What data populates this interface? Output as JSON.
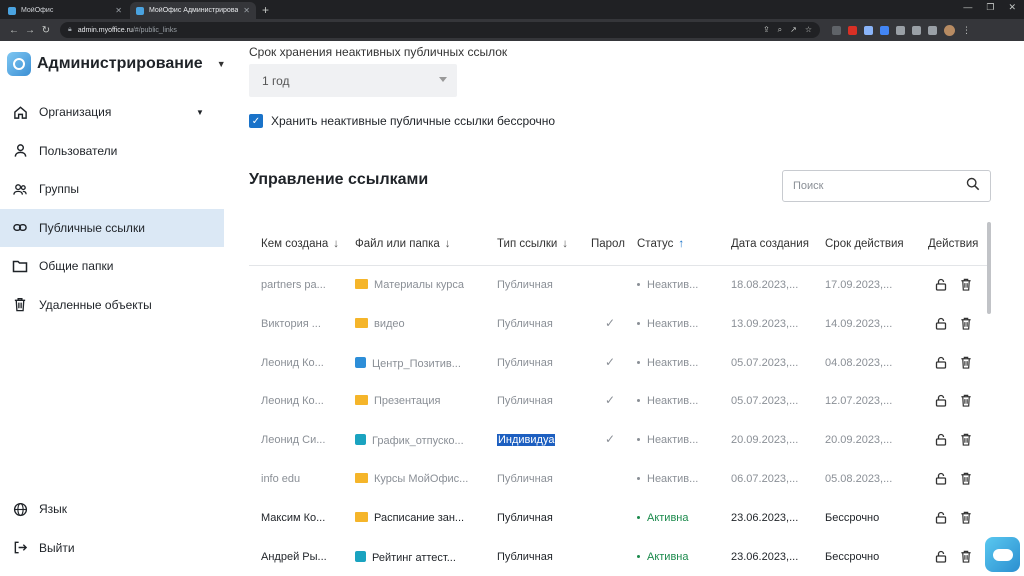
{
  "browser": {
    "tabs": [
      {
        "title": "МойОфис",
        "active": false
      },
      {
        "title": "МойОфис Администрирование",
        "active": true
      }
    ],
    "url_host": "admin.myoffice.ru",
    "url_path": "/#/public_links"
  },
  "sidebar": {
    "title": "Администрирование",
    "items": [
      {
        "label": "Организация",
        "icon": "home-icon",
        "active": false,
        "has_caret": true
      },
      {
        "label": "Пользователи",
        "icon": "user-icon",
        "active": false
      },
      {
        "label": "Группы",
        "icon": "group-icon",
        "active": false
      },
      {
        "label": "Публичные ссылки",
        "icon": "link-icon",
        "active": true
      },
      {
        "label": "Общие папки",
        "icon": "folder-icon",
        "active": false
      },
      {
        "label": "Удаленные объекты",
        "icon": "trash-icon",
        "active": false
      }
    ],
    "bottom_items": [
      {
        "label": "Язык",
        "icon": "globe-icon"
      },
      {
        "label": "Выйти",
        "icon": "logout-icon"
      }
    ]
  },
  "settings": {
    "retention_label": "Срок хранения неактивных публичных ссылок",
    "retention_value": "1 год",
    "keep_forever_label": "Хранить неактивные публичные ссылки бессрочно",
    "keep_forever_checked": true
  },
  "links": {
    "title": "Управление ссылками",
    "search_placeholder": "Поиск",
    "columns": [
      {
        "label": "Кем создана",
        "sort": "down"
      },
      {
        "label": "Файл или папка",
        "sort": "down"
      },
      {
        "label": "Тип ссылки",
        "sort": "down"
      },
      {
        "label": "Парол",
        "sort": ""
      },
      {
        "label": "Статус",
        "sort": "up"
      },
      {
        "label": "Дата создания",
        "sort": ""
      },
      {
        "label": "Срок действия",
        "sort": ""
      },
      {
        "label": "Действия",
        "sort": ""
      }
    ],
    "rows": [
      {
        "creator": "partners pa...",
        "item": "Материалы курса",
        "item_type": "folder",
        "link_type": "Публичная",
        "password": false,
        "status": "Неактив...",
        "created": "18.08.2023,...",
        "expires": "17.09.2023,...",
        "active": false
      },
      {
        "creator": "Виктория ...",
        "item": "видео",
        "item_type": "folder",
        "link_type": "Публичная",
        "password": true,
        "status": "Неактив...",
        "created": "13.09.2023,...",
        "expires": "14.09.2023,...",
        "active": false
      },
      {
        "creator": "Леонид Ко...",
        "item": "Центр_Позитив...",
        "item_type": "doc-blue",
        "link_type": "Публичная",
        "password": true,
        "status": "Неактив...",
        "created": "05.07.2023,...",
        "expires": "04.08.2023,...",
        "active": false
      },
      {
        "creator": "Леонид Ко...",
        "item": "Презентация",
        "item_type": "folder",
        "link_type": "Публичная",
        "password": true,
        "status": "Неактив...",
        "created": "05.07.2023,...",
        "expires": "12.07.2023,...",
        "active": false
      },
      {
        "creator": "Леонид Си...",
        "item": "График_отпуско...",
        "item_type": "doc",
        "link_type": "Индивидуа",
        "password": true,
        "status": "Неактив...",
        "created": "20.09.2023,...",
        "expires": "20.09.2023,...",
        "active": false,
        "highlight_type": true
      },
      {
        "creator": "info edu",
        "item": "Курсы МойОфис...",
        "item_type": "folder",
        "link_type": "Публичная",
        "password": false,
        "status": "Неактив...",
        "created": "06.07.2023,...",
        "expires": "05.08.2023,...",
        "active": false
      },
      {
        "creator": "Максим Ко...",
        "item": "Расписание зан...",
        "item_type": "folder",
        "link_type": "Публичная",
        "password": false,
        "status": "Активна",
        "created": "23.06.2023,...",
        "expires": "Бессрочно",
        "active": true
      },
      {
        "creator": "Андрей Ры...",
        "item": "Рейтинг аттест...",
        "item_type": "doc",
        "link_type": "Публичная",
        "password": false,
        "status": "Активна",
        "created": "23.06.2023,...",
        "expires": "Бессрочно",
        "active": true
      }
    ]
  },
  "colors": {
    "accent": "#1a73c9",
    "active_nav": "#dbe8f5",
    "active_status": "#1b8a4c",
    "folder": "#f5b52a"
  }
}
